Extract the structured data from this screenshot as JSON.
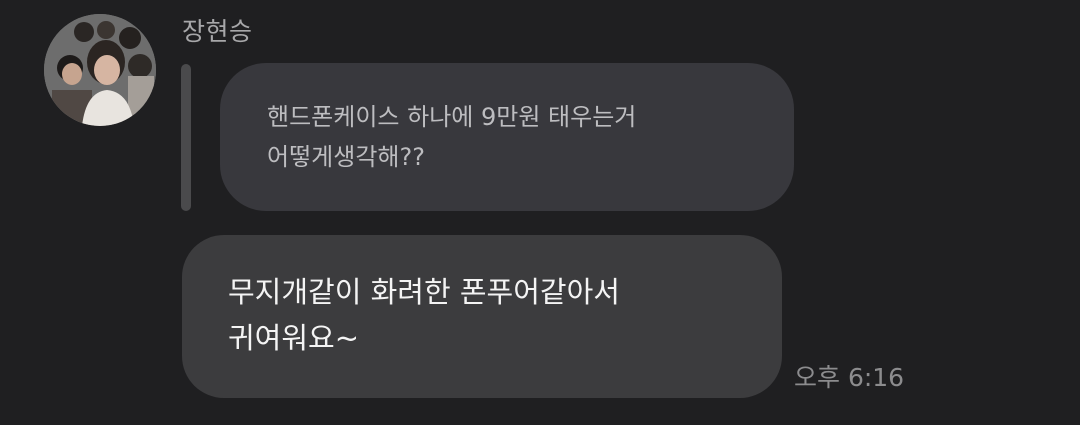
{
  "message": {
    "sender_name": "장현승",
    "avatar_icon": "group-photo-avatar",
    "quoted": {
      "lines": [
        "핸드폰케이스 하나에 9만원 태우는거",
        "어떻게생각해??"
      ]
    },
    "reply": {
      "lines": [
        "무지개같이 화려한 폰푸어같아서",
        "귀여워요~"
      ]
    },
    "timestamp": "오후 6:16"
  },
  "colors": {
    "background": "#1f1f21",
    "quoted_bubble": "#38383d",
    "reply_bubble": "#3c3c3e",
    "quote_bar": "#4a4a4c",
    "sender_text": "#a7a7a9",
    "timestamp_text": "#8c8c8e"
  }
}
